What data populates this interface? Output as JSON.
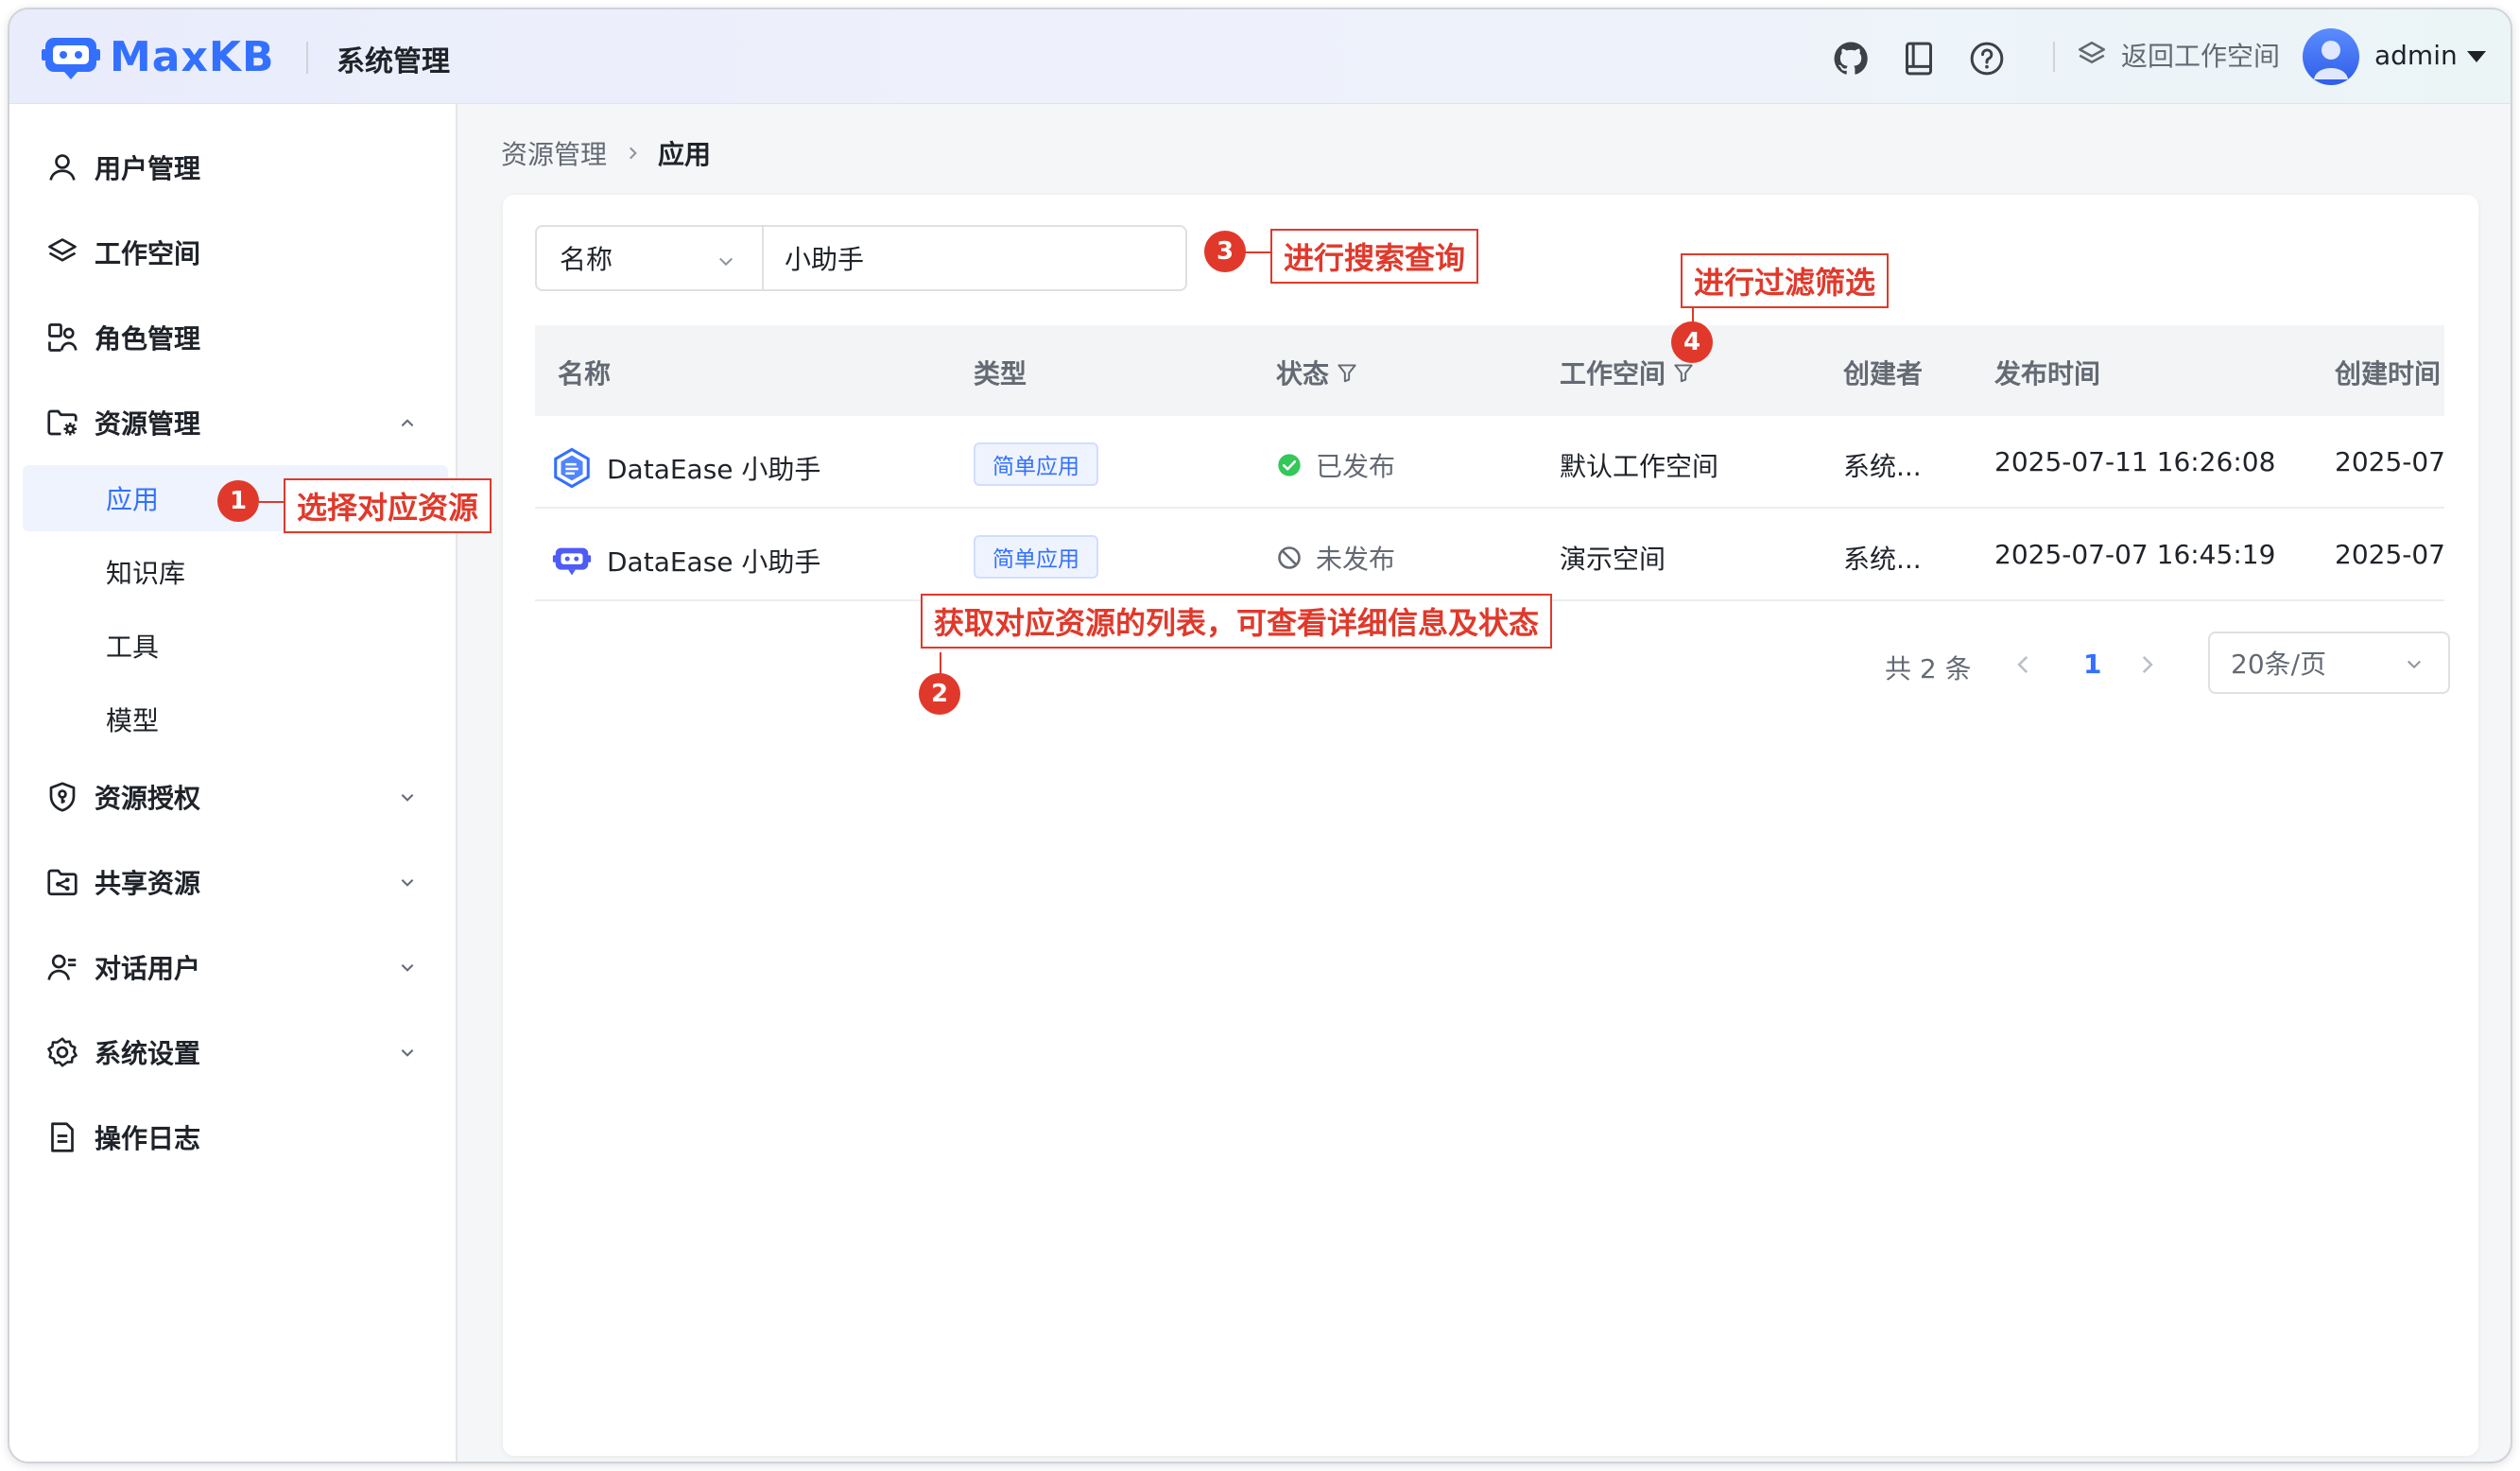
{
  "header": {
    "logo_text": "MaxKB",
    "title": "系统管理",
    "back_workspace_label": "返回工作空间",
    "user_name": "admin",
    "icons": [
      "github-icon",
      "book-icon",
      "help-icon",
      "layers-icon"
    ]
  },
  "sidebar": {
    "items": [
      {
        "label": "用户管理",
        "icon": "user-icon"
      },
      {
        "label": "工作空间",
        "icon": "layers-icon"
      },
      {
        "label": "角色管理",
        "icon": "role-icon"
      },
      {
        "label": "资源管理",
        "icon": "folder-gear-icon",
        "expanded": true
      },
      {
        "label": "资源授权",
        "icon": "shield-key-icon"
      },
      {
        "label": "共享资源",
        "icon": "folder-share-icon"
      },
      {
        "label": "对话用户",
        "icon": "chat-user-icon"
      },
      {
        "label": "系统设置",
        "icon": "gear-icon"
      },
      {
        "label": "操作日志",
        "icon": "document-icon"
      }
    ],
    "sub_items": [
      {
        "label": "应用",
        "active": true
      },
      {
        "label": "知识库"
      },
      {
        "label": "工具"
      },
      {
        "label": "模型"
      }
    ]
  },
  "breadcrumb": {
    "parent": "资源管理",
    "current": "应用"
  },
  "search": {
    "field": "名称",
    "value": "小助手"
  },
  "table": {
    "columns": [
      "名称",
      "类型",
      "状态",
      "工作空间",
      "创建者",
      "发布时间",
      "创建时间"
    ],
    "rows": [
      {
        "name": "DataEase 小助手",
        "icon": "dataease-icon",
        "type": "简单应用",
        "status": "已发布",
        "status_icon": "check-circle-icon",
        "workspace": "默认工作空间",
        "creator": "系统...",
        "publish_time": "2025-07-11 16:26:08",
        "create_time": "2025-07"
      },
      {
        "name": "DataEase 小助手",
        "icon": "maxkb-robot-icon",
        "type": "简单应用",
        "status": "未发布",
        "status_icon": "ban-icon",
        "workspace": "演示空间",
        "creator": "系统...",
        "publish_time": "2025-07-07 16:45:19",
        "create_time": "2025-07"
      }
    ]
  },
  "pagination": {
    "total_text": "共 2 条",
    "current_page": "1",
    "page_size": "20条/页"
  },
  "annotations": [
    {
      "number": "1",
      "text": "选择对应资源"
    },
    {
      "number": "2",
      "text": "获取对应资源的列表，可查看详细信息及状态"
    },
    {
      "number": "3",
      "text": "进行搜索查询"
    },
    {
      "number": "4",
      "text": "进行过滤筛选"
    }
  ],
  "colors": {
    "accent": "#3370ff",
    "annotation": "#e0392b",
    "success": "#34c759"
  }
}
